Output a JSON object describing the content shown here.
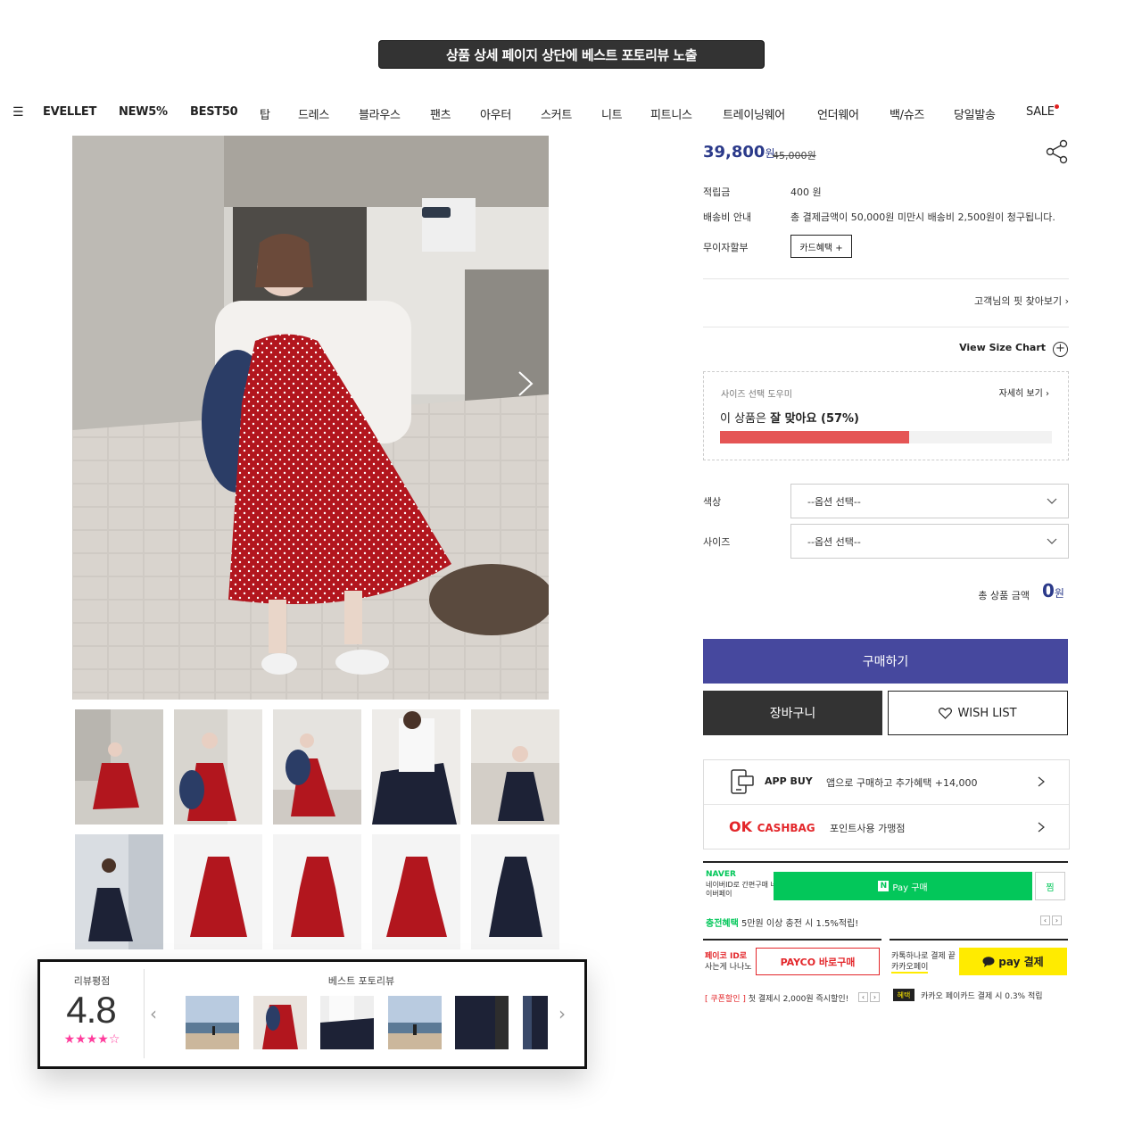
{
  "callout": "상품 상세 페이지 상단에 베스트 포토리뷰 노출",
  "nav": {
    "items": [
      "EVELLET",
      "NEW5%",
      "BEST50",
      "탑",
      "드레스",
      "블라우스",
      "팬츠",
      "아우터",
      "스커트",
      "니트",
      "피트니스",
      "트레이닝웨어",
      "언더웨어",
      "백/슈즈",
      "당일발송",
      "SALE"
    ]
  },
  "product": {
    "price": "39,800",
    "price_unit": "원",
    "orig_price": "45,000원",
    "info": [
      {
        "label": "적립금",
        "value": "400 원"
      },
      {
        "label": "배송비 안내",
        "value": "총 결제금액이 50,000원 미만시 배송비 2,500원이 청구됩니다."
      },
      {
        "label": "무이자할부",
        "value": ""
      }
    ],
    "card_benefit": "카드혜택 +",
    "fit_link": "고객님의 핏 찾아보기",
    "size_chart": "View Size Chart"
  },
  "fit": {
    "title": "사이즈 선택 도우미",
    "detail": "자세히 보기",
    "text_prefix": "이 상품은 ",
    "text_bold": "잘 맞아요 (57%)",
    "percent": 57
  },
  "options": [
    {
      "label": "색상",
      "placeholder": "--옵션 선택--"
    },
    {
      "label": "사이즈",
      "placeholder": "--옵션 선택--"
    }
  ],
  "total": {
    "label": "총 상품 금액",
    "value": "0",
    "unit": "원"
  },
  "buttons": {
    "buy": "구매하기",
    "cart": "장바구니",
    "wish": "WISH LIST"
  },
  "promo": {
    "app_buy": "APP BUY",
    "app_desc": "앱으로 구매하고 추가혜택 +14,000",
    "ok_logo": "OK",
    "ok_brand": "CASHBAG",
    "ok_desc": "포인트사용 가맹점"
  },
  "naver": {
    "logo": "NAVER",
    "sub": "네이버ID로 간편구매 네이버페이",
    "pay_label": "Pay 구매",
    "jjim": "찜",
    "foot_bold": "충전혜택",
    "foot": " 5만원 이상 충전 시 1.5%적립!"
  },
  "payco": {
    "label": "페이코 ID로",
    "label2": "사는게 나나노",
    "button": "PAYCO 바로구매",
    "foot_bold": "[ 쿠폰할인 ]",
    "foot": " 첫 결제시 2,000원 즉시할인!"
  },
  "kakao": {
    "label": "카톡하나로 결제 끝",
    "label2": "카카오페이",
    "button": "pay 결제",
    "badge": "혜택",
    "foot": "카카오 페이카드 결제 시 0.3% 적립"
  },
  "review": {
    "label": "리뷰평점",
    "score": "4.8",
    "stars": "★★★★☆",
    "best_label": "베스트 포토리뷰"
  },
  "colors": {
    "accent": "#46489e",
    "price": "#2b3a8a",
    "fit_bar": "#e55555",
    "naver": "#03c75a",
    "kakao": "#ffeb00",
    "payco": "#e3262a",
    "stars": "#ff3c9c"
  }
}
